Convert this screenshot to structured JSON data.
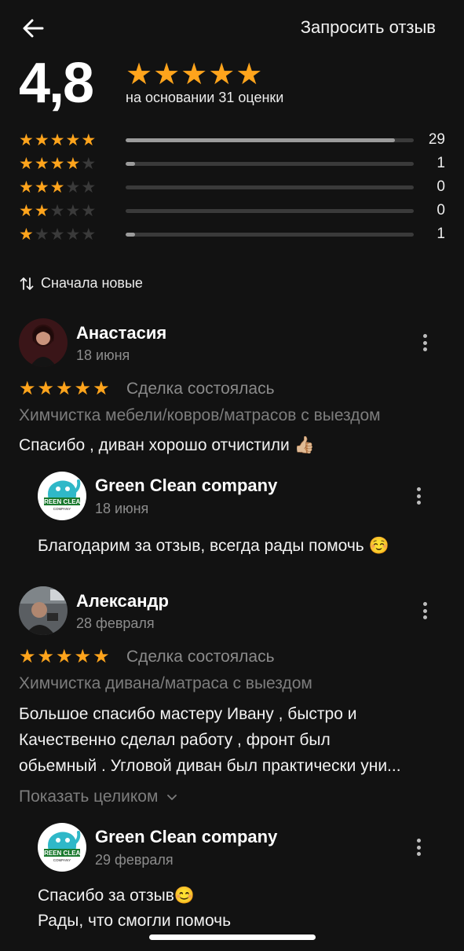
{
  "header": {
    "request_label": "Запросить отзыв"
  },
  "summary": {
    "rating": "4,8",
    "stars": "★★★★★",
    "based_on": "на основании 31 оценки"
  },
  "distribution": [
    {
      "stars": 5,
      "count": "29",
      "fraction": 0.935
    },
    {
      "stars": 4,
      "count": "1",
      "fraction": 0.032
    },
    {
      "stars": 3,
      "count": "0",
      "fraction": 0
    },
    {
      "stars": 2,
      "count": "0",
      "fraction": 0
    },
    {
      "stars": 1,
      "count": "1",
      "fraction": 0.032
    }
  ],
  "sort": {
    "label": "Сначала новые"
  },
  "reviews": [
    {
      "name": "Анастасия",
      "date": "18 июня",
      "stars": "★★★★★",
      "deal": "Сделка состоялась",
      "service": "Химчистка мебели/ковров/матрасов с выездом",
      "text": "Спасибо , диван хорошо отчистили 👍🏼",
      "reply": {
        "name": "Green Clean company",
        "date": "18 июня",
        "text": "Благодарим за отзыв, всегда рады помочь ☺️"
      }
    },
    {
      "name": "Александр",
      "date": "28 февраля",
      "stars": "★★★★★",
      "deal": "Сделка состоялась",
      "service": "Химчистка дивана/матраса с выездом",
      "text_lines": [
        "Большое спасибо мастеру Ивану , быстро и",
        "Качественно сделал работу , фронт был",
        "обьемный . Угловой диван был практически уни..."
      ],
      "show_more": "Показать целиком",
      "reply": {
        "name": "Green Clean company",
        "date": "29 февраля",
        "text_lines": [
          "Спасибо за отзыв😊",
          "Рады, что смогли помочь"
        ]
      }
    }
  ],
  "logo_text": {
    "line1": "GREEN CLEAN",
    "line2": "COMPANY"
  }
}
